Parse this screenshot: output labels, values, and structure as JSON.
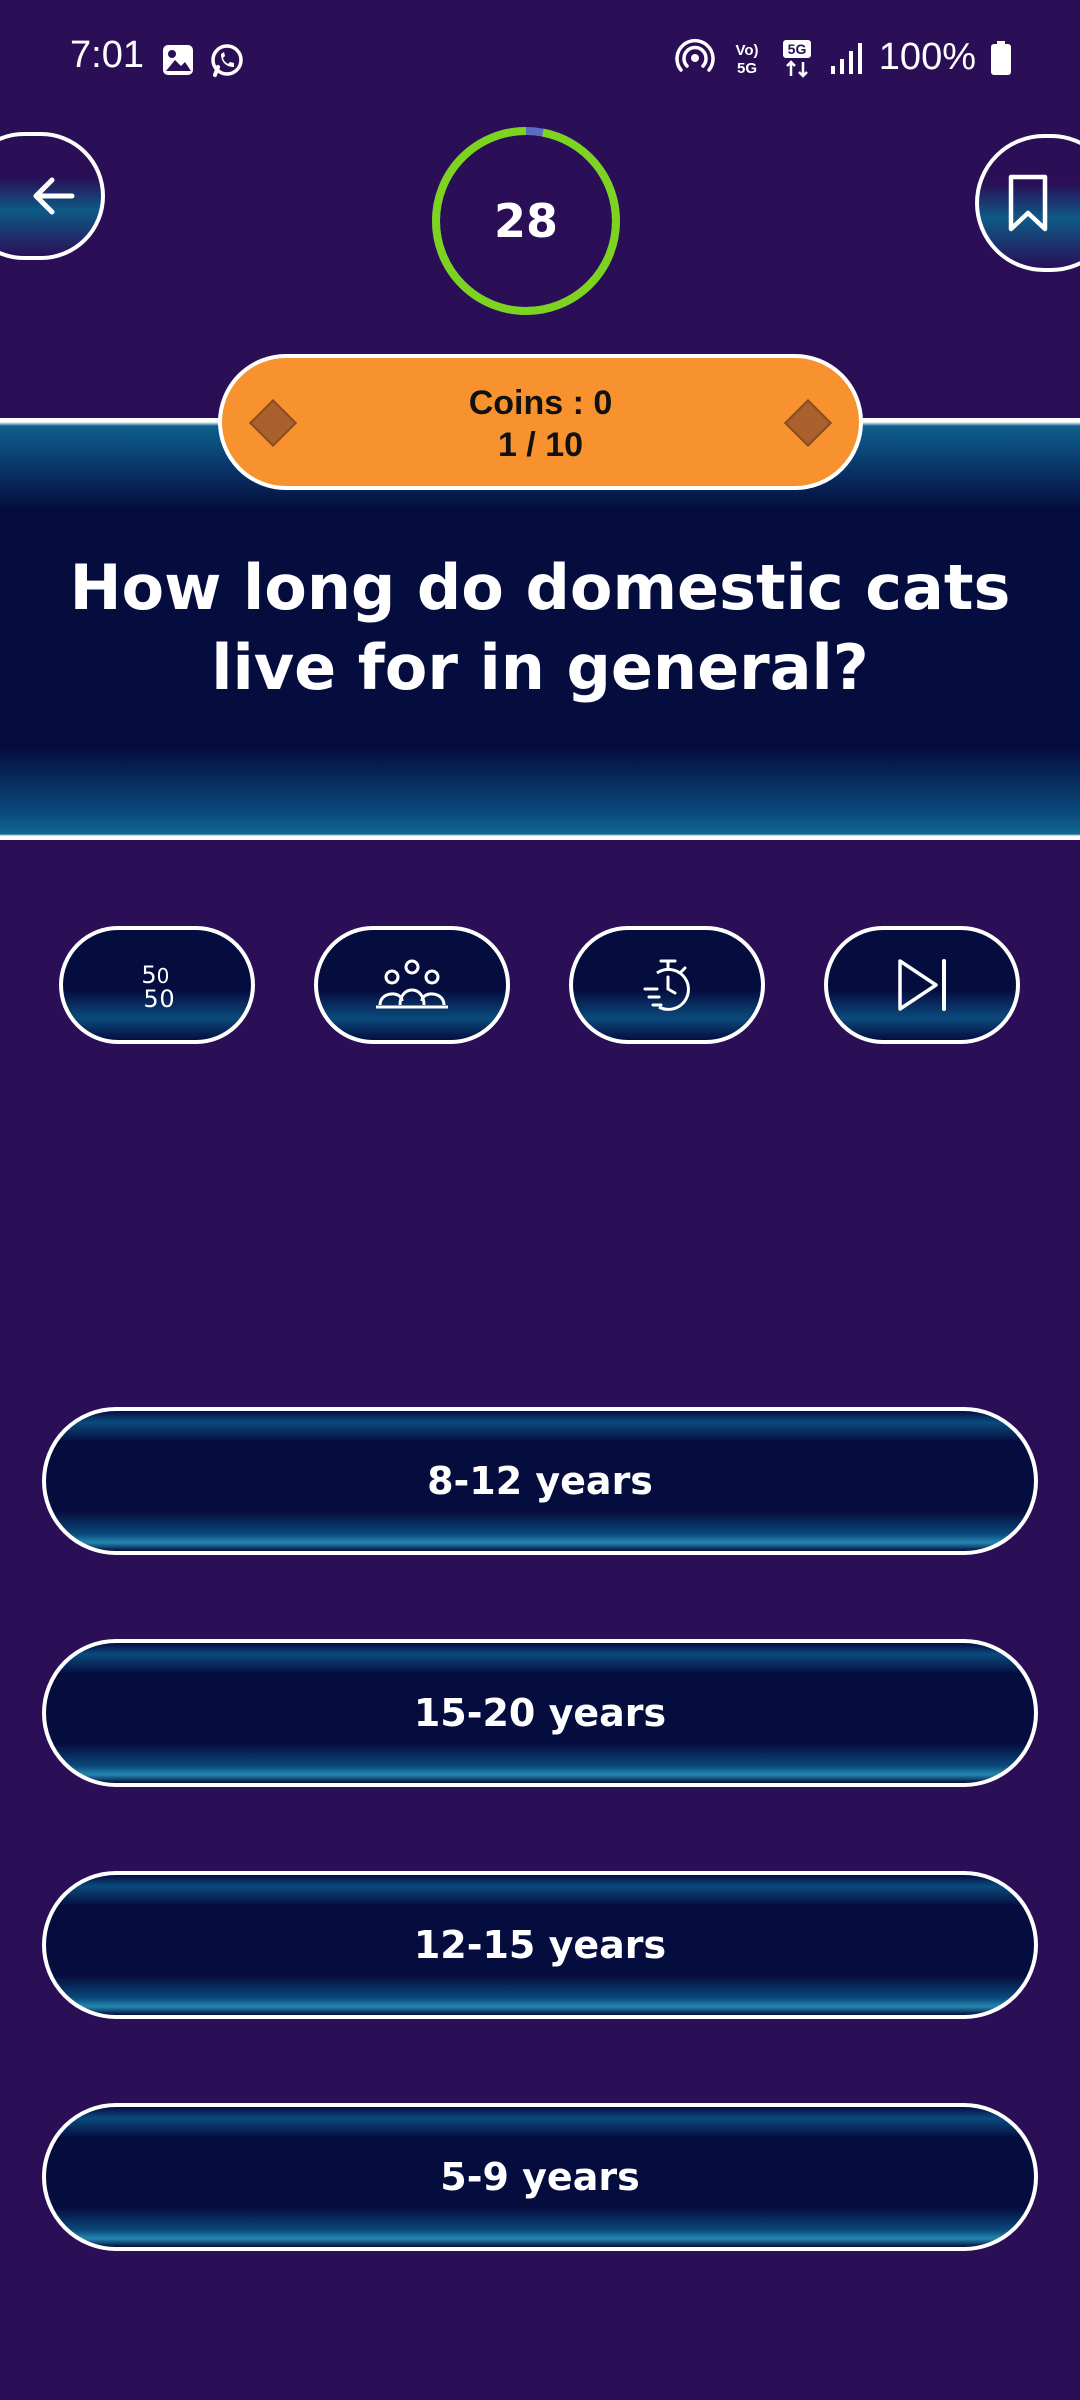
{
  "status_bar": {
    "time": "7:01",
    "battery": "100%",
    "icons": [
      "gallery-icon",
      "whatsapp-icon",
      "hotspot-icon",
      "volte-icon",
      "5g-icon",
      "signal-icon",
      "battery-icon"
    ]
  },
  "header": {
    "back_icon": "arrow-left-icon",
    "bookmark_icon": "bookmark-icon",
    "timer": {
      "seconds": "28",
      "progress_fraction": 0.97
    }
  },
  "coins": {
    "label": "Coins : 0",
    "progress": "1 / 10"
  },
  "question": {
    "text": "How long do domestic cats live for in general?"
  },
  "lifelines": [
    {
      "name": "fifty-fifty",
      "icon": "fifty-fifty-icon"
    },
    {
      "name": "audience-poll",
      "icon": "audience-icon"
    },
    {
      "name": "timer",
      "icon": "stopwatch-icon"
    },
    {
      "name": "skip",
      "icon": "skip-icon"
    }
  ],
  "answers": [
    {
      "label": "8-12 years"
    },
    {
      "label": "15-20 years"
    },
    {
      "label": "12-15 years"
    },
    {
      "label": "5-9 years"
    }
  ],
  "colors": {
    "background": "#2a0f57",
    "banner": "#050d3f",
    "accent_teal": "#0b4a7c",
    "coins_pill": "#f7922e",
    "timer_ring": "#7ed321",
    "timer_track": "#5b6cc4"
  }
}
